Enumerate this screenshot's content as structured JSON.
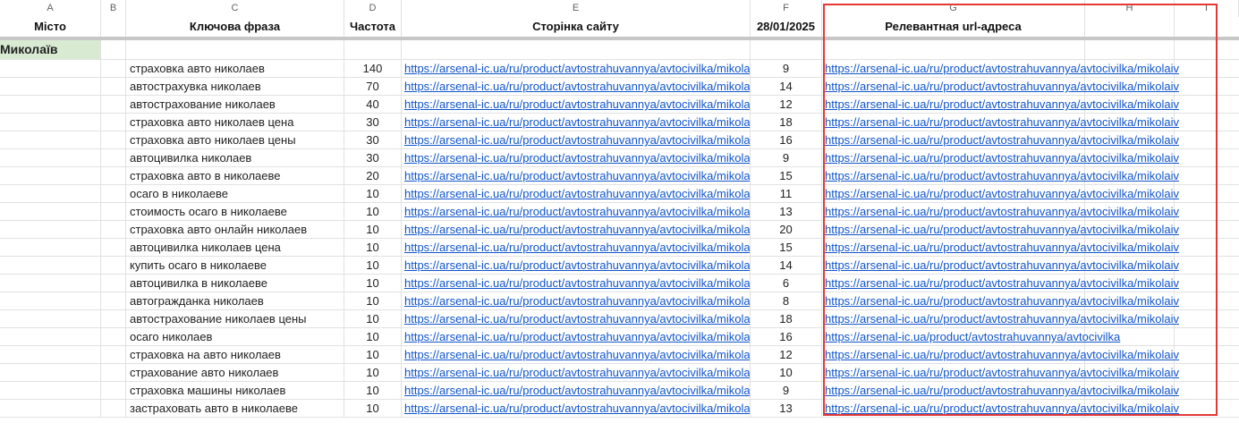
{
  "sheet": {
    "col_letters": [
      "A",
      "B",
      "C",
      "D",
      "E",
      "F",
      "G",
      "H",
      "I"
    ],
    "headers": {
      "a": "Місто",
      "c": "Ключова фраза",
      "d": "Частота",
      "e": "Сторінка сайту",
      "f": "28/01/2025",
      "g": "Релевантная url-адреса"
    },
    "city": "Миколаїв",
    "rows": [
      {
        "phrase": "страховка авто николаев",
        "freq": "140",
        "page": "https://arsenal-ic.ua/ru/product/avtostrahuvannya/avtocivilka/mikolaiv",
        "pos": "9",
        "rel": "https://arsenal-ic.ua/ru/product/avtostrahuvannya/avtocivilka/mikolaiv"
      },
      {
        "phrase": "автострахувка николаев",
        "freq": "70",
        "page": "https://arsenal-ic.ua/ru/product/avtostrahuvannya/avtocivilka/mikolaiv",
        "pos": "14",
        "rel": "https://arsenal-ic.ua/ru/product/avtostrahuvannya/avtocivilka/mikolaiv"
      },
      {
        "phrase": "автострахование николаев",
        "freq": "40",
        "page": "https://arsenal-ic.ua/ru/product/avtostrahuvannya/avtocivilka/mikolaiv",
        "pos": "12",
        "rel": "https://arsenal-ic.ua/ru/product/avtostrahuvannya/avtocivilka/mikolaiv"
      },
      {
        "phrase": "страховка авто николаев цена",
        "freq": "30",
        "page": "https://arsenal-ic.ua/ru/product/avtostrahuvannya/avtocivilka/mikolaiv",
        "pos": "18",
        "rel": "https://arsenal-ic.ua/ru/product/avtostrahuvannya/avtocivilka/mikolaiv"
      },
      {
        "phrase": "страховка авто николаев цены",
        "freq": "30",
        "page": "https://arsenal-ic.ua/ru/product/avtostrahuvannya/avtocivilka/mikolaiv",
        "pos": "16",
        "rel": "https://arsenal-ic.ua/ru/product/avtostrahuvannya/avtocivilka/mikolaiv"
      },
      {
        "phrase": "автоцивилка николаев",
        "freq": "30",
        "page": "https://arsenal-ic.ua/ru/product/avtostrahuvannya/avtocivilka/mikolaiv",
        "pos": "9",
        "rel": "https://arsenal-ic.ua/ru/product/avtostrahuvannya/avtocivilka/mikolaiv"
      },
      {
        "phrase": "страховка авто в николаеве",
        "freq": "20",
        "page": "https://arsenal-ic.ua/ru/product/avtostrahuvannya/avtocivilka/mikolaiv",
        "pos": "15",
        "rel": "https://arsenal-ic.ua/ru/product/avtostrahuvannya/avtocivilka/mikolaiv"
      },
      {
        "phrase": "осаго в николаеве",
        "freq": "10",
        "page": "https://arsenal-ic.ua/ru/product/avtostrahuvannya/avtocivilka/mikolaiv",
        "pos": "11",
        "rel": "https://arsenal-ic.ua/ru/product/avtostrahuvannya/avtocivilka/mikolaiv"
      },
      {
        "phrase": "стоимость осаго в николаеве",
        "freq": "10",
        "page": "https://arsenal-ic.ua/ru/product/avtostrahuvannya/avtocivilka/mikolaiv",
        "pos": "13",
        "rel": "https://arsenal-ic.ua/ru/product/avtostrahuvannya/avtocivilka/mikolaiv"
      },
      {
        "phrase": "страховка авто онлайн николаев",
        "freq": "10",
        "page": "https://arsenal-ic.ua/ru/product/avtostrahuvannya/avtocivilka/mikolaiv",
        "pos": "20",
        "rel": "https://arsenal-ic.ua/ru/product/avtostrahuvannya/avtocivilka/mikolaiv"
      },
      {
        "phrase": "автоцивилка николаев цена",
        "freq": "10",
        "page": "https://arsenal-ic.ua/ru/product/avtostrahuvannya/avtocivilka/mikolaiv",
        "pos": "15",
        "rel": "https://arsenal-ic.ua/ru/product/avtostrahuvannya/avtocivilka/mikolaiv"
      },
      {
        "phrase": "купить осаго в николаеве",
        "freq": "10",
        "page": "https://arsenal-ic.ua/ru/product/avtostrahuvannya/avtocivilka/mikolaiv",
        "pos": "14",
        "rel": "https://arsenal-ic.ua/ru/product/avtostrahuvannya/avtocivilka/mikolaiv"
      },
      {
        "phrase": "автоцивилка в николаеве",
        "freq": "10",
        "page": "https://arsenal-ic.ua/ru/product/avtostrahuvannya/avtocivilka/mikolaiv",
        "pos": "6",
        "rel": "https://arsenal-ic.ua/ru/product/avtostrahuvannya/avtocivilka/mikolaiv"
      },
      {
        "phrase": "автогражданка николаев",
        "freq": "10",
        "page": "https://arsenal-ic.ua/ru/product/avtostrahuvannya/avtocivilka/mikolaiv",
        "pos": "8",
        "rel": "https://arsenal-ic.ua/ru/product/avtostrahuvannya/avtocivilka/mikolaiv"
      },
      {
        "phrase": "автострахование николаев цены",
        "freq": "10",
        "page": "https://arsenal-ic.ua/ru/product/avtostrahuvannya/avtocivilka/mikolaiv",
        "pos": "18",
        "rel": "https://arsenal-ic.ua/ru/product/avtostrahuvannya/avtocivilka/mikolaiv"
      },
      {
        "phrase": "осаго николаев",
        "freq": "10",
        "page": "https://arsenal-ic.ua/ru/product/avtostrahuvannya/avtocivilka/mikolaiv",
        "pos": "16",
        "rel": "https://arsenal-ic.ua/product/avtostrahuvannya/avtocivilka"
      },
      {
        "phrase": "страховка на авто николаев",
        "freq": "10",
        "page": "https://arsenal-ic.ua/ru/product/avtostrahuvannya/avtocivilka/mikolaiv",
        "pos": "12",
        "rel": "https://arsenal-ic.ua/ru/product/avtostrahuvannya/avtocivilka/mikolaiv"
      },
      {
        "phrase": "страхование авто николаев",
        "freq": "10",
        "page": "https://arsenal-ic.ua/ru/product/avtostrahuvannya/avtocivilka/mikolaiv",
        "pos": "10",
        "rel": "https://arsenal-ic.ua/ru/product/avtostrahuvannya/avtocivilka/mikolaiv"
      },
      {
        "phrase": "страховка машины николаев",
        "freq": "10",
        "page": "https://arsenal-ic.ua/ru/product/avtostrahuvannya/avtocivilka/mikolaiv",
        "pos": "9",
        "rel": "https://arsenal-ic.ua/ru/product/avtostrahuvannya/avtocivilka/mikolaiv"
      },
      {
        "phrase": "застраховать авто в николаеве",
        "freq": "10",
        "page": "https://arsenal-ic.ua/ru/product/avtostrahuvannya/avtocivilka/mikolaiv",
        "pos": "13",
        "rel": "https://arsenal-ic.ua/ru/product/avtostrahuvannya/avtocivilka/mikolaiv"
      }
    ]
  },
  "colors": {
    "link": "#1155cc",
    "city_fill": "#d9ead3",
    "highlight_border": "#e53935"
  }
}
